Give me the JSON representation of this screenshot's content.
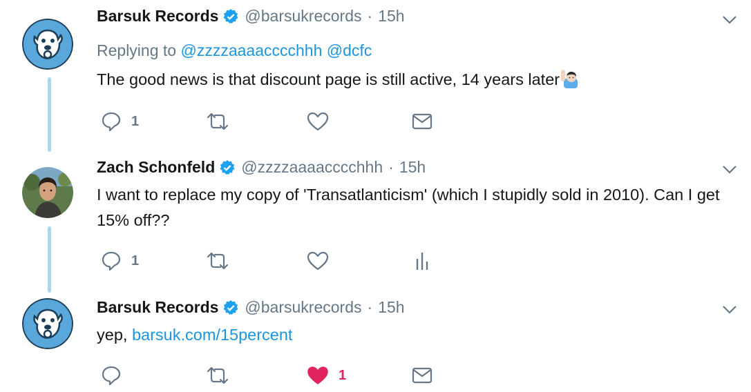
{
  "tweets": [
    {
      "name": "Barsuk Records",
      "handle": "@barsukrecords",
      "separator": "·",
      "time": "15h",
      "replying_label": "Replying to",
      "mention1": "@zzzzaaaacccchhh",
      "mention2": "@dcfc",
      "text": "The good news is that discount page is still active, 14 years later",
      "reply_count": "1",
      "avatar_icon": "barsuk-dog-logo-icon",
      "emoji_icon": "man-raising-hand-emoji"
    },
    {
      "name": "Zach Schonfeld",
      "handle": "@zzzzaaaacccchhh",
      "separator": "·",
      "time": "15h",
      "text": "I want to replace my copy of 'Transatlanticism' (which I stupidly sold in 2010). Can I get 15% off??",
      "reply_count": "1",
      "avatar_icon": "profile-photo"
    },
    {
      "name": "Barsuk Records",
      "handle": "@barsukrecords",
      "separator": "·",
      "time": "15h",
      "text_prefix": "yep,",
      "link": "barsuk.com/15percent",
      "like_count": "1",
      "avatar_icon": "barsuk-dog-logo-icon"
    }
  ],
  "colors": {
    "link": "#1b95e0",
    "muted": "#657786",
    "like": "#e0245e",
    "thread": "#a8d8ea",
    "verified": "#1da1f2"
  }
}
